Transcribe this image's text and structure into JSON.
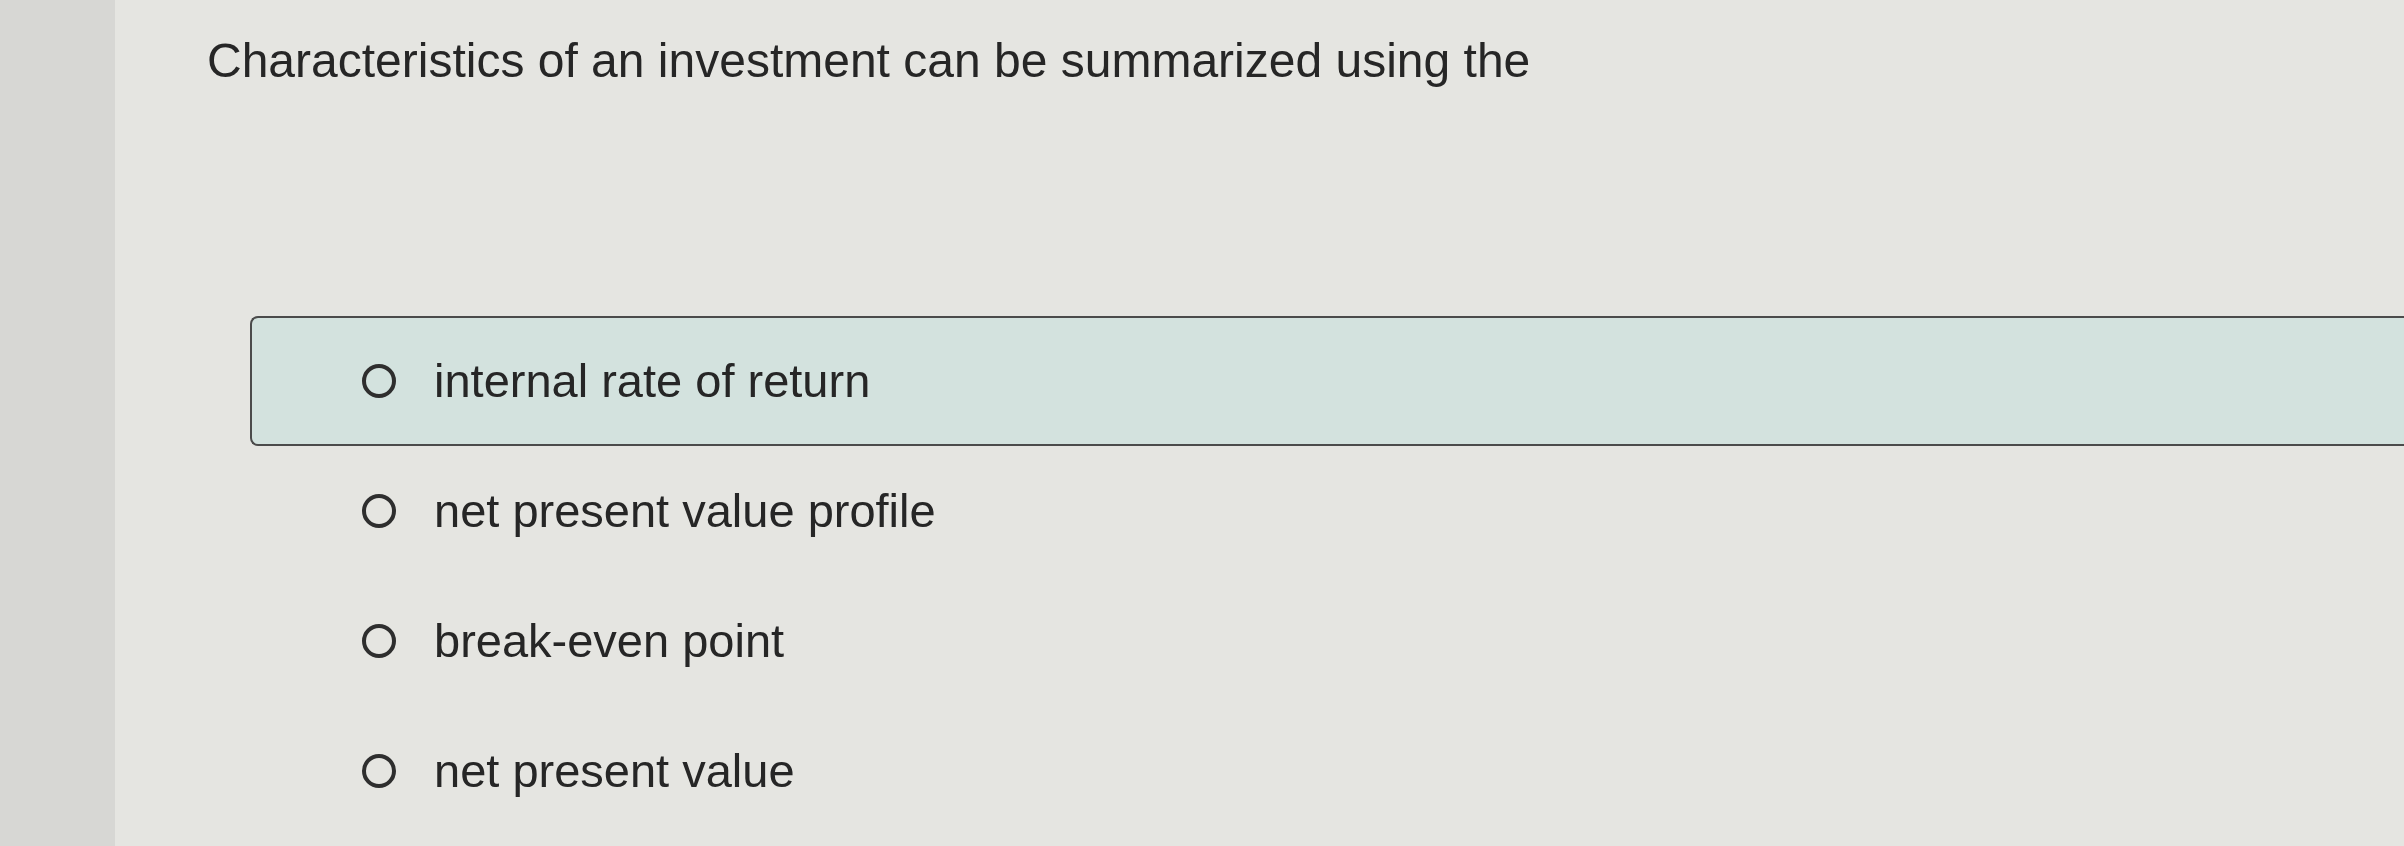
{
  "question": {
    "text": "Characteristics of an investment can be summarized using the"
  },
  "options": [
    {
      "label": "internal rate of return",
      "selected": false,
      "highlighted": true
    },
    {
      "label": "net present value profile",
      "selected": false,
      "highlighted": false
    },
    {
      "label": "break-even point",
      "selected": false,
      "highlighted": false
    },
    {
      "label": "net present value",
      "selected": false,
      "highlighted": false
    }
  ]
}
